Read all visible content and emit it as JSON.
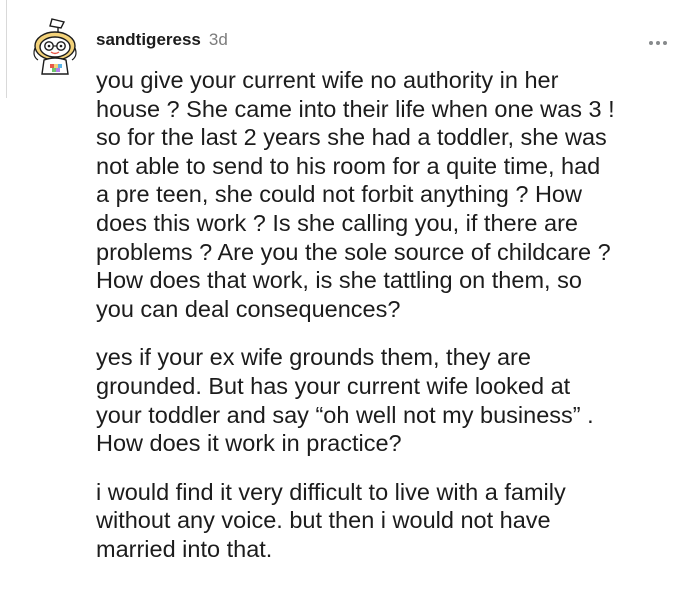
{
  "comment": {
    "username": "sandtigeress",
    "timestamp": "3d",
    "more_label": "•••",
    "paragraphs": [
      "you give your current wife no authority in her\nhouse ? She came into their life when one was 3 !\nso for the last 2 years she had a toddler, she was\nnot able to send to his room for a quite time, had\na pre teen, she could not forbit anything ? How\ndoes this work ? Is she calling you, if there are\nproblems ? Are you the sole source of childcare ?\nHow does that work, is she tattling on them, so\nyou can deal consequences?",
      "yes if your ex wife grounds them, they are\ngrounded. But has your current wife looked at\nyour toddler and say “oh well not my business” .\nHow does it work in practice?",
      "i would find it very difficult to live with a family\nwithout any voice. but then i would not have\nmarried into that."
    ]
  },
  "colors": {
    "text": "#1c1c1c",
    "meta": "#7c7c7c",
    "avatar_hair": "#f3d27a",
    "avatar_accent": "#e8594a"
  },
  "icons": {
    "avatar": "snoo-avatar-icon",
    "more": "more-options-icon"
  }
}
